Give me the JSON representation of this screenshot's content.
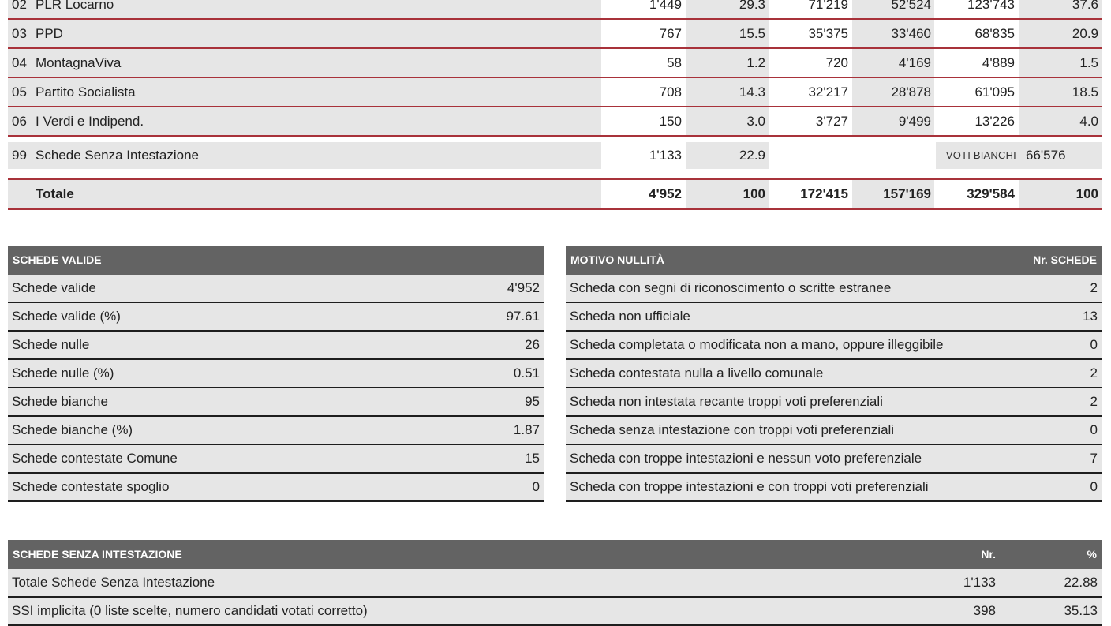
{
  "results": {
    "rows": [
      {
        "code": "02",
        "name": "PLR Locarno",
        "schede": "1'449",
        "pct": "29.3",
        "v1": "71'219",
        "v2": "52'524",
        "tot": "123'743",
        "pct2": "37.6"
      },
      {
        "code": "03",
        "name": "PPD",
        "schede": "767",
        "pct": "15.5",
        "v1": "35'375",
        "v2": "33'460",
        "tot": "68'835",
        "pct2": "20.9"
      },
      {
        "code": "04",
        "name": "MontagnaViva",
        "schede": "58",
        "pct": "1.2",
        "v1": "720",
        "v2": "4'169",
        "tot": "4'889",
        "pct2": "1.5"
      },
      {
        "code": "05",
        "name": "Partito Socialista",
        "schede": "708",
        "pct": "14.3",
        "v1": "32'217",
        "v2": "28'878",
        "tot": "61'095",
        "pct2": "18.5"
      },
      {
        "code": "06",
        "name": "I Verdi e Indipend.",
        "schede": "150",
        "pct": "3.0",
        "v1": "3'727",
        "v2": "9'499",
        "tot": "13'226",
        "pct2": "4.0"
      }
    ],
    "ssi": {
      "code": "99",
      "name": "Schede Senza Intestazione",
      "schede": "1'133",
      "pct": "22.9",
      "blank_label": "VOTI BIANCHI",
      "blank_value": "66'576"
    },
    "total": {
      "name": "Totale",
      "schede": "4'952",
      "pct": "100",
      "v1": "172'415",
      "v2": "157'169",
      "tot": "329'584",
      "pct2": "100"
    }
  },
  "valid_panel": {
    "title": "SCHEDE VALIDE",
    "rows": [
      {
        "label": "Schede valide",
        "value": "4'952"
      },
      {
        "label": "Schede valide (%)",
        "value": "97.61"
      },
      {
        "label": "Schede nulle",
        "value": "26"
      },
      {
        "label": "Schede nulle (%)",
        "value": "0.51"
      },
      {
        "label": "Schede bianche",
        "value": "95"
      },
      {
        "label": "Schede bianche (%)",
        "value": "1.87"
      },
      {
        "label": "Schede contestate Comune",
        "value": "15"
      },
      {
        "label": "Schede contestate spoglio",
        "value": "0"
      }
    ]
  },
  "null_panel": {
    "title": "MOTIVO NULLITÀ",
    "col_header": "Nr. SCHEDE",
    "rows": [
      {
        "label": "Scheda con segni di riconoscimento o scritte estranee",
        "value": "2"
      },
      {
        "label": "Scheda non ufficiale",
        "value": "13"
      },
      {
        "label": "Scheda completata o modificata non a mano, oppure illeggibile",
        "value": "0"
      },
      {
        "label": "Scheda contestata nulla a livello comunale",
        "value": "2"
      },
      {
        "label": "Scheda non intestata recante troppi voti preferenziali",
        "value": "2"
      },
      {
        "label": "Scheda senza intestazione con troppi voti preferenziali",
        "value": "0"
      },
      {
        "label": "Scheda con troppe intestazioni e nessun voto preferenziale",
        "value": "7"
      },
      {
        "label": "Scheda con troppe intestazioni e con troppi voti preferenziali",
        "value": "0"
      }
    ]
  },
  "ssi_panel": {
    "title": "SCHEDE SENZA INTESTAZIONE",
    "col_nr": "Nr.",
    "col_pct": "%",
    "rows": [
      {
        "label": "Totale Schede Senza Intestazione",
        "nr": "1'133",
        "pct": "22.88"
      },
      {
        "label": "SSI implicita (0 liste scelte, numero candidati votati corretto)",
        "nr": "398",
        "pct": "35.13"
      }
    ]
  }
}
